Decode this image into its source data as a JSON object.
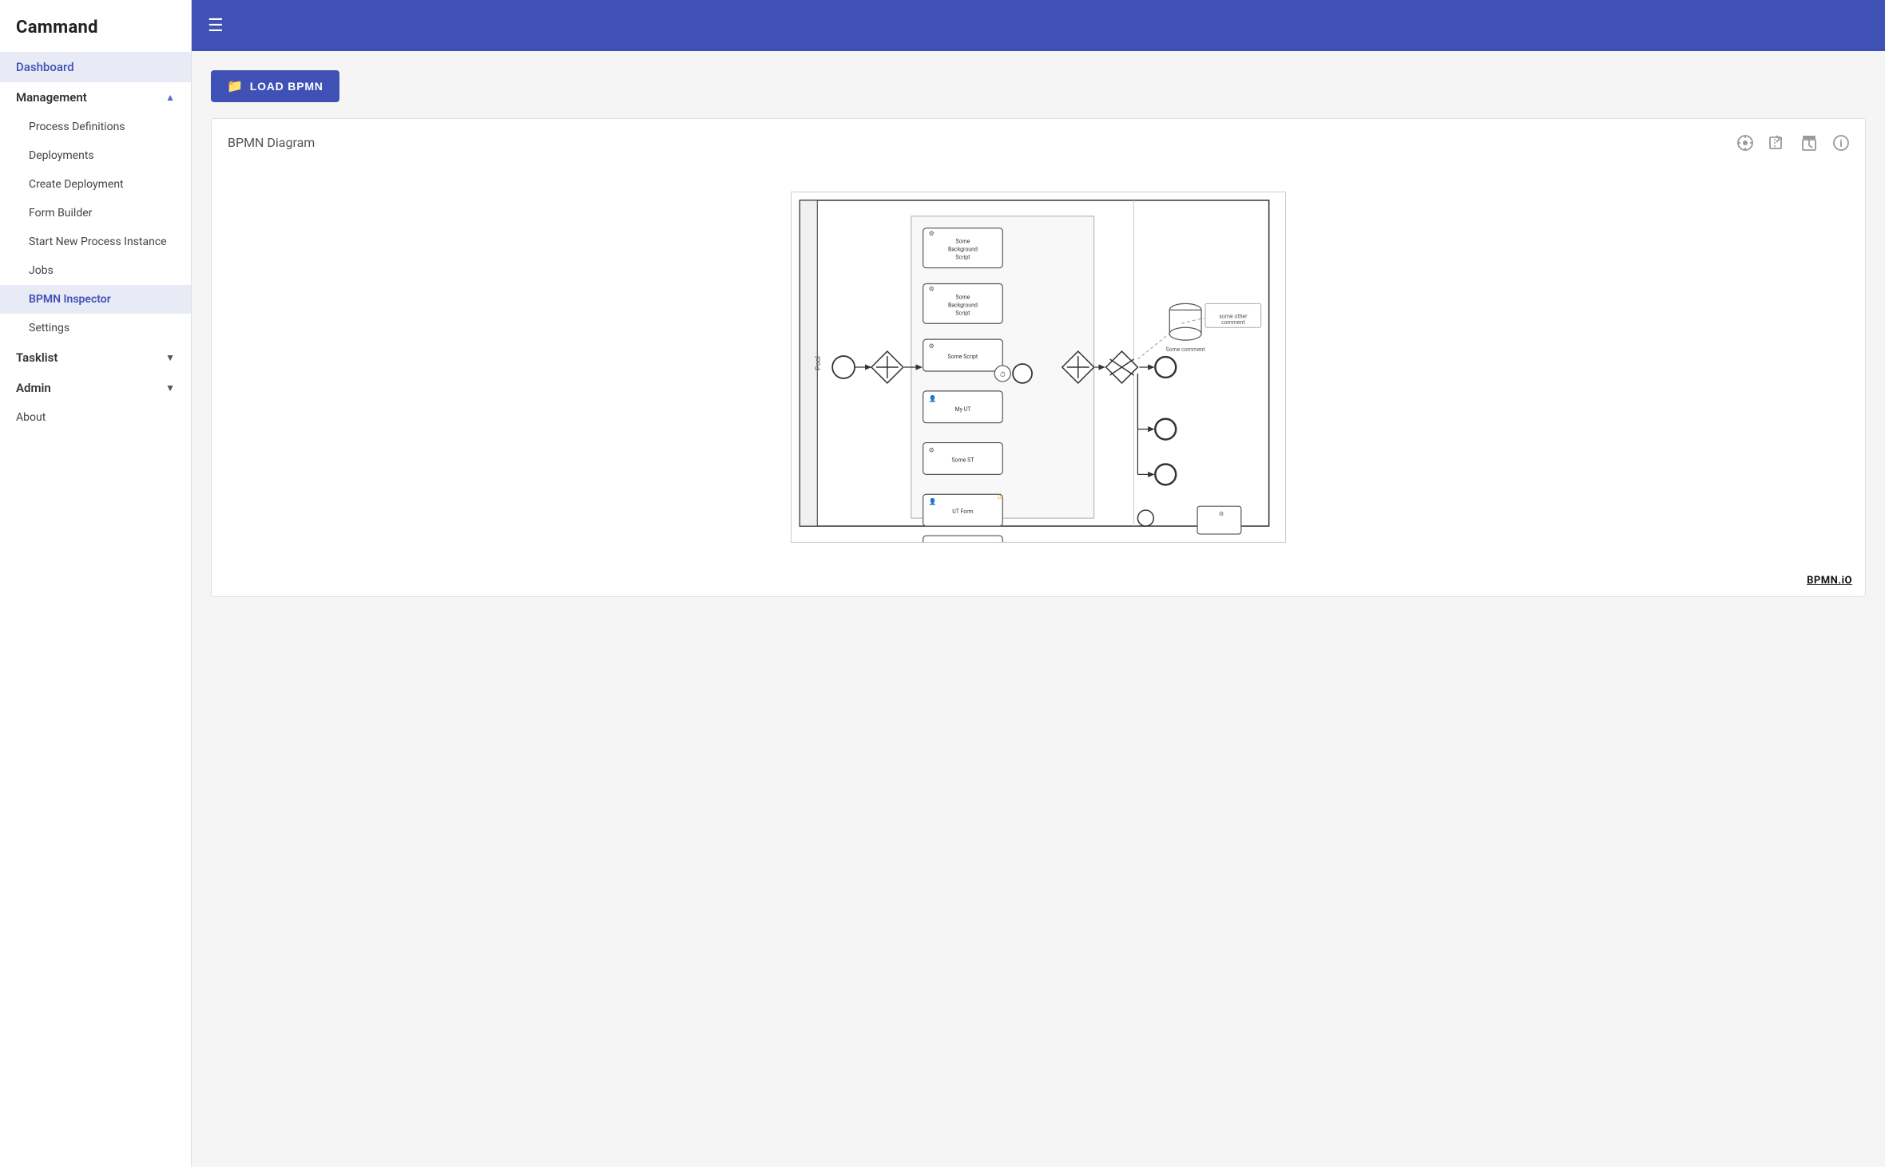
{
  "app": {
    "title": "Cammand"
  },
  "topbar": {
    "hamburger_label": "☰"
  },
  "sidebar": {
    "dashboard_label": "Dashboard",
    "management": {
      "label": "Management",
      "expanded": true,
      "items": [
        {
          "id": "process-definitions",
          "label": "Process Definitions"
        },
        {
          "id": "deployments",
          "label": "Deployments"
        },
        {
          "id": "create-deployment",
          "label": "Create Deployment"
        },
        {
          "id": "form-builder",
          "label": "Form Builder"
        },
        {
          "id": "start-new-process-instance",
          "label": "Start New Process Instance"
        },
        {
          "id": "jobs",
          "label": "Jobs"
        },
        {
          "id": "bpmn-inspector",
          "label": "BPMN Inspector",
          "active": true
        },
        {
          "id": "settings",
          "label": "Settings"
        }
      ]
    },
    "tasklist": {
      "label": "Tasklist",
      "expanded": false
    },
    "admin": {
      "label": "Admin",
      "expanded": false
    },
    "about_label": "About"
  },
  "content": {
    "load_bpmn_label": "LOAD BPMN",
    "bpmn_card_title": "BPMN Diagram",
    "bpmnio_watermark": "BPMN.iO",
    "icons": [
      {
        "id": "target-icon",
        "symbol": "⊕",
        "title": "Center"
      },
      {
        "id": "export-icon",
        "symbol": "⬡",
        "title": "Export"
      },
      {
        "id": "timer-icon",
        "symbol": "⧗",
        "title": "Timer"
      },
      {
        "id": "info-icon",
        "symbol": "ℹ",
        "title": "Info"
      }
    ]
  }
}
